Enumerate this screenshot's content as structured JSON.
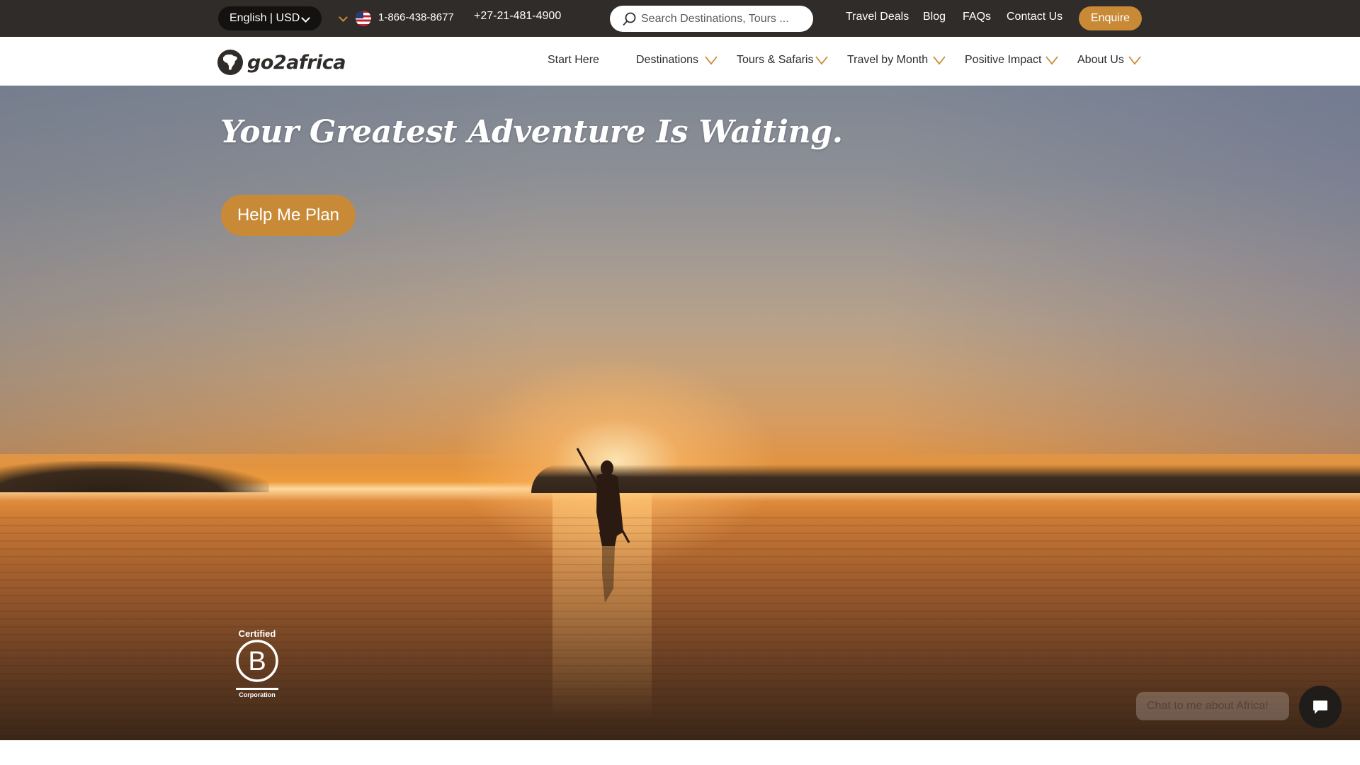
{
  "topbar": {
    "language_currency": "English | USD",
    "phone_us": "1-866-438-8677",
    "phone_intl": "+27-21-481-4900",
    "search": {
      "placeholder": "Search Destinations, Tours ..."
    },
    "links": [
      {
        "label": "Travel Deals"
      },
      {
        "label": "Blog"
      },
      {
        "label": "FAQs"
      },
      {
        "label": "Contact Us"
      }
    ],
    "enquire_label": "Enquire"
  },
  "nav": {
    "logo_text": "go2africa",
    "items": [
      {
        "label": "Start Here"
      },
      {
        "label": "Destinations"
      },
      {
        "label": "Tours & Safaris"
      },
      {
        "label": "Travel by Month"
      },
      {
        "label": "Positive Impact"
      },
      {
        "label": "About Us"
      }
    ]
  },
  "hero": {
    "title": "Your Greatest Adventure Is Waiting.",
    "cta_label": "Help Me Plan"
  },
  "badge": {
    "top": "Certified",
    "letter": "B",
    "bottom": "Corporation"
  },
  "chat": {
    "prompt": "Chat to me about Africa!"
  },
  "colors": {
    "accent": "#c98a38",
    "topbar_bg": "#2f2c2a",
    "text_dark": "#2f2c2a"
  },
  "icons": {
    "search": "search-icon",
    "flag": "us-flag-icon",
    "chevron": "chevron-down-icon",
    "chat": "chat-bubble-icon"
  }
}
